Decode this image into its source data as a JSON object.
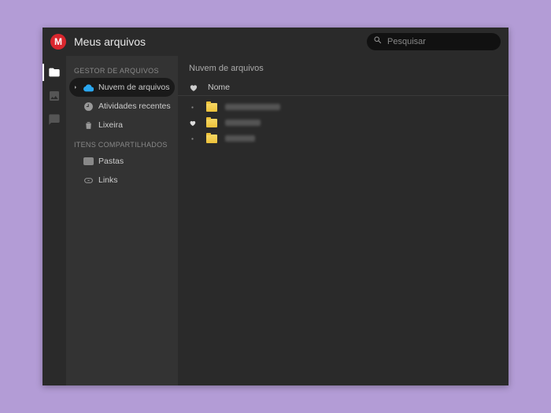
{
  "header": {
    "logo_letter": "M",
    "title": "Meus arquivos",
    "search_placeholder": "Pesquisar"
  },
  "sidebar": {
    "section_file_manager": "GESTOR DE ARQUIVOS",
    "cloud_drive": "Nuvem de arquivos",
    "recent": "Atividades recentes",
    "trash": "Lixeira",
    "section_shared": "ITENS COMPARTILHADOS",
    "folders": "Pastas",
    "links": "Links"
  },
  "main": {
    "breadcrumb": "Nuvem de arquivos",
    "column_name": "Nome"
  },
  "colors": {
    "brand": "#d9272e",
    "accent": "#2aa7f0"
  }
}
